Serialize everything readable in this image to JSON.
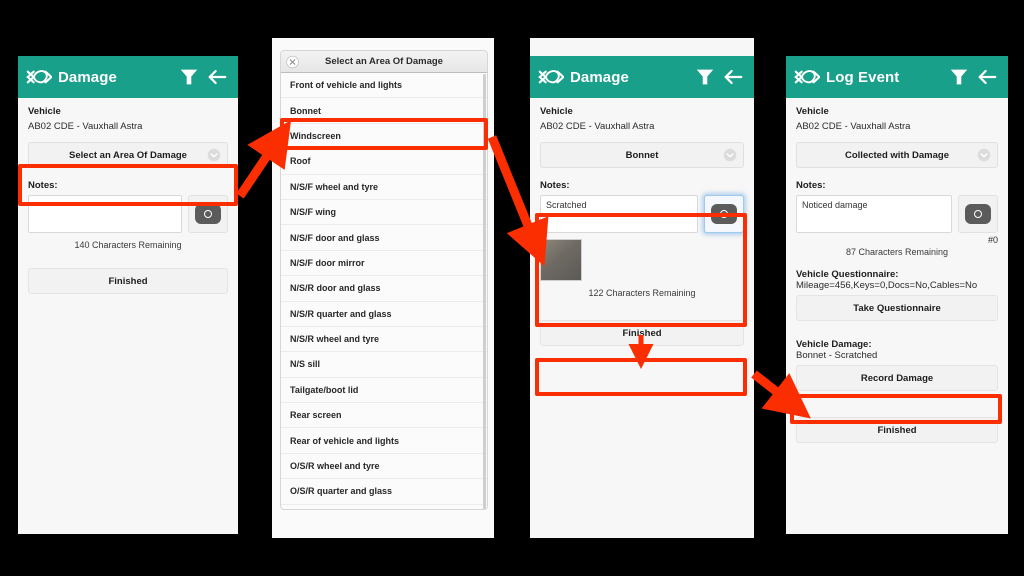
{
  "panel1": {
    "header": {
      "title": "Damage",
      "logo_icon": "damage-logo-icon",
      "filter_icon": "filter-icon",
      "back_icon": "back-arrow-icon"
    },
    "vehicle_label": "Vehicle",
    "vehicle_value": "AB02 CDE - Vauxhall Astra",
    "select_button": "Select an Area Of Damage",
    "notes_label": "Notes:",
    "notes_value": "",
    "notes_placeholder": "",
    "characters_remaining": "140 Characters Remaining",
    "finished_button": "Finished",
    "camera_icon": "camera-icon",
    "chevron_icon": "chevron-down-icon"
  },
  "panel2": {
    "dialog_title": "Select an Area Of Damage",
    "close_icon": "close-icon",
    "items": [
      "Front of vehicle and lights",
      "Bonnet",
      "Windscreen",
      "Roof",
      "N/S/F wheel and tyre",
      "N/S/F wing",
      "N/S/F door and glass",
      "N/S/F door mirror",
      "N/S/R door and glass",
      "N/S/R quarter and glass",
      "N/S/R wheel and tyre",
      "N/S sill",
      "Tailgate/boot lid",
      "Rear screen",
      "Rear of vehicle and lights",
      "O/S/R wheel and tyre",
      "O/S/R quarter and glass"
    ],
    "highlighted_item": "Bonnet"
  },
  "panel3": {
    "header": {
      "title": "Damage",
      "logo_icon": "damage-logo-icon",
      "filter_icon": "filter-icon",
      "back_icon": "back-arrow-icon"
    },
    "vehicle_label": "Vehicle",
    "vehicle_value": "AB02 CDE - Vauxhall Astra",
    "select_button": "Bonnet",
    "notes_label": "Notes:",
    "notes_value": "Scratched",
    "characters_remaining": "122 Characters Remaining",
    "finished_button": "Finished",
    "camera_icon": "camera-icon",
    "chevron_icon": "chevron-down-icon",
    "thumbnail_alt": "damage-photo-thumbnail"
  },
  "panel4": {
    "header": {
      "title": "Log Event",
      "logo_icon": "damage-logo-icon",
      "filter_icon": "filter-icon",
      "back_icon": "back-arrow-icon"
    },
    "vehicle_label": "Vehicle",
    "vehicle_value": "AB02 CDE - Vauxhall Astra",
    "select_button": "Collected with Damage",
    "notes_label": "Notes:",
    "notes_value": "Noticed damage",
    "photo_count": "#0",
    "characters_remaining": "87 Characters Remaining",
    "questionnaire_label": "Vehicle Questionnaire:",
    "questionnaire_value": "Mileage=456,Keys=0,Docs=No,Cables=No",
    "take_questionnaire_button": "Take Questionnaire",
    "vehicle_damage_label": "Vehicle Damage:",
    "vehicle_damage_value": "Bonnet - Scratched",
    "record_damage_button": "Record Damage",
    "finished_button": "Finished",
    "camera_icon": "camera-icon",
    "chevron_icon": "chevron-down-icon"
  },
  "annotations": {
    "highlight_color": "#fb2e01",
    "arrow_color": "#fb2e01",
    "accent_color": "#18a08a"
  }
}
